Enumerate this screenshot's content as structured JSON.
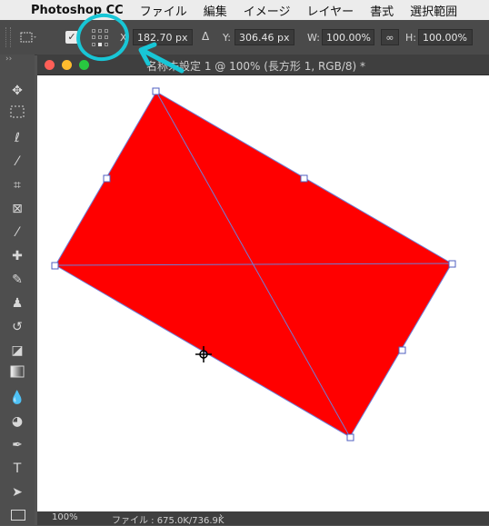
{
  "menubar": {
    "apple": "",
    "app_name": "Photoshop CC",
    "items": [
      "ファイル",
      "編集",
      "イメージ",
      "レイヤー",
      "書式",
      "選択範囲"
    ]
  },
  "options": {
    "x_label": "X",
    "x_value": "182.70 px",
    "y_label": "Y:",
    "y_value": "306.46 px",
    "w_label": "W:",
    "w_value": "100.00%",
    "h_label": "H:",
    "h_value": "100.00%",
    "delta_icon": "Δ",
    "link_icon": "∞"
  },
  "document": {
    "title": "名称未設定 1 @ 100% (長方形 1, RGB/8) *"
  },
  "status": {
    "zoom": "100%",
    "file_info": "ファイル : 675.0K/736.9K",
    "arrow": "›"
  },
  "colors": {
    "shape_fill": "#ff0000",
    "path_stroke": "#6f7fd6",
    "annotation": "#18c6d6"
  },
  "icons": {
    "menubar": [
      "apple-icon"
    ],
    "options": [
      "transform-tool-icon",
      "checkbox-icon",
      "reference-point-grid-icon",
      "link-icon"
    ],
    "tools": [
      "move-icon",
      "marquee-icon",
      "lasso-icon",
      "magic-wand-icon",
      "crop-icon",
      "frame-icon",
      "eyedropper-icon",
      "healing-brush-icon",
      "brush-icon",
      "stamp-icon",
      "history-brush-icon",
      "eraser-icon",
      "gradient-icon",
      "blur-icon",
      "dodge-icon",
      "pen-icon",
      "type-icon",
      "path-selection-icon",
      "rectangle-icon"
    ]
  }
}
